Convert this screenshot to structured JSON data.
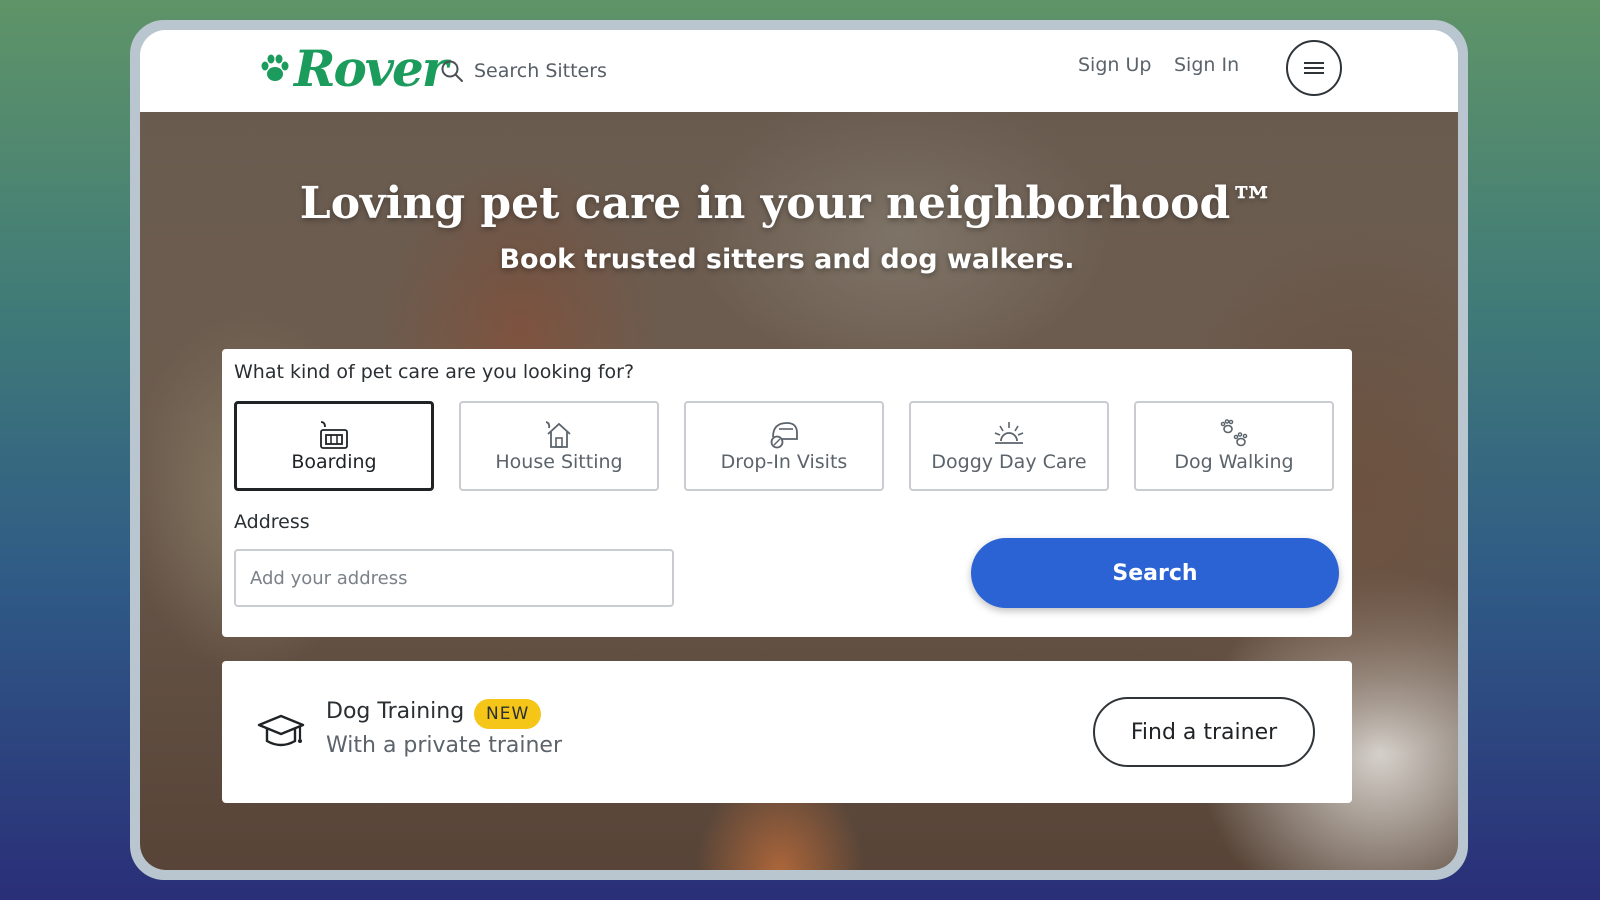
{
  "nav": {
    "logo_text": "Rover",
    "search_label": "Search Sitters",
    "sign_up": "Sign Up",
    "sign_in": "Sign In"
  },
  "hero": {
    "title": "Loving pet care in your neighborhood™",
    "subtitle": "Book trusted sitters and dog walkers."
  },
  "search_card": {
    "question": "What kind of pet care are you looking for?",
    "services": [
      {
        "label": "Boarding",
        "icon": "boarding-icon",
        "selected": true
      },
      {
        "label": "House Sitting",
        "icon": "house-icon",
        "selected": false
      },
      {
        "label": "Drop-In Visits",
        "icon": "pet-bowl-icon",
        "selected": false
      },
      {
        "label": "Doggy Day Care",
        "icon": "sun-icon",
        "selected": false
      },
      {
        "label": "Dog Walking",
        "icon": "paw-prints-icon",
        "selected": false
      }
    ],
    "address_label": "Address",
    "address_placeholder": "Add your address",
    "search_button": "Search"
  },
  "training": {
    "title": "Dog Training",
    "badge": "NEW",
    "subtitle": "With a private trainer",
    "button": "Find a trainer"
  },
  "colors": {
    "brand_green": "#1b9b5c",
    "search_blue": "#2b63d4",
    "badge_yellow": "#f5c518"
  }
}
